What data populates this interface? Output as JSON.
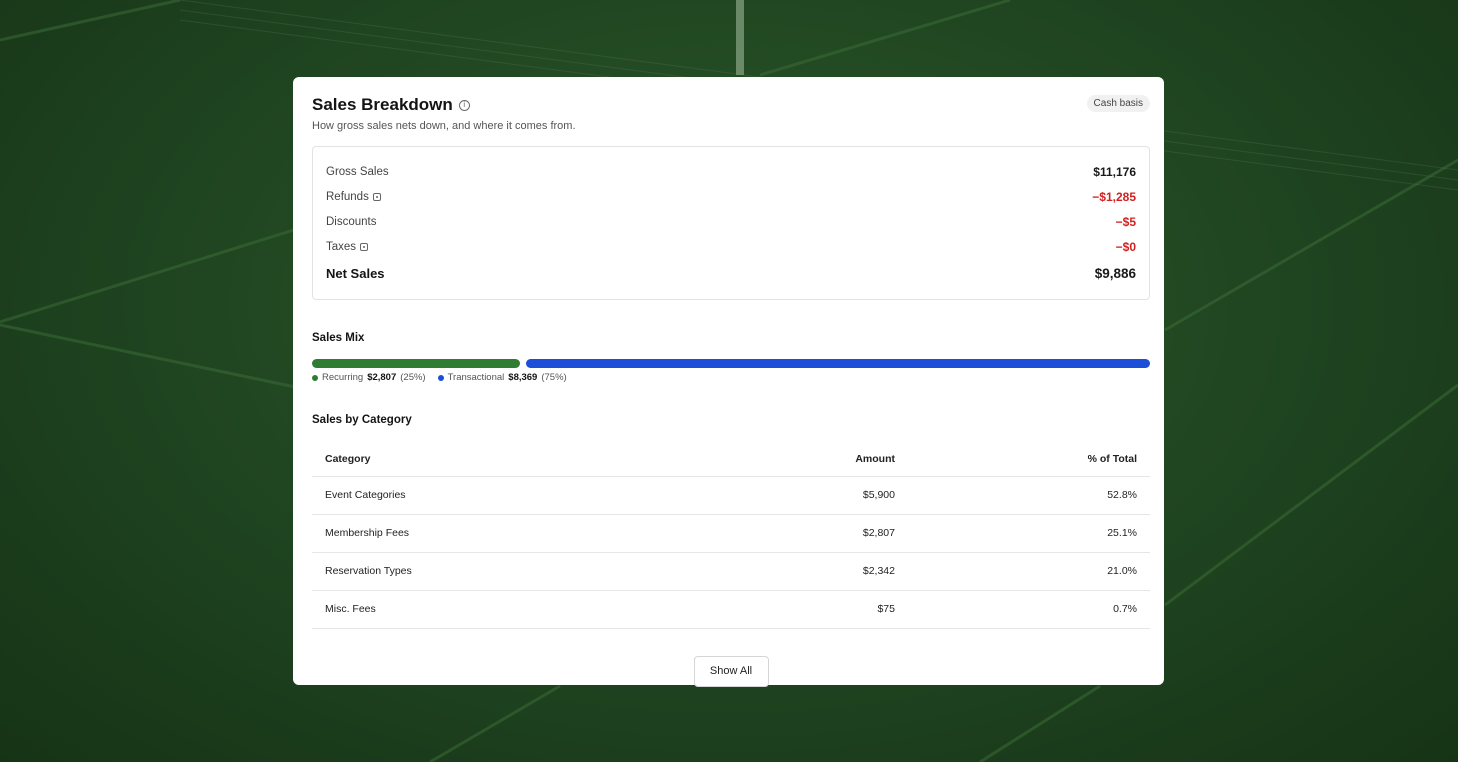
{
  "card": {
    "title": "Sales Breakdown",
    "info_icon": "info-icon",
    "badge": "Cash basis",
    "subtitle": "How gross sales nets down, and where it comes from."
  },
  "summary": {
    "gross": {
      "label": "Gross Sales",
      "value": "$11,176"
    },
    "refunds": {
      "label": "Refunds",
      "value": "−$1,285"
    },
    "discounts": {
      "label": "Discounts",
      "value": "−$5"
    },
    "taxes": {
      "label": "Taxes",
      "value": "−$0"
    },
    "net": {
      "label": "Net Sales",
      "value": "$9,886"
    }
  },
  "mix": {
    "title": "Sales Mix",
    "recurring": {
      "label": "Recurring",
      "amount": "$2,807",
      "pct": "(25%)",
      "fraction": 0.25,
      "color": "#2e7d32"
    },
    "transactional": {
      "label": "Transactional",
      "amount": "$8,369",
      "pct": "(75%)",
      "fraction": 0.75,
      "color": "#1d4ed8"
    }
  },
  "categories": {
    "title": "Sales by Category",
    "headers": {
      "category": "Category",
      "amount": "Amount",
      "pct": "% of Total"
    },
    "rows": [
      {
        "category": "Event Categories",
        "amount": "$5,900",
        "pct": "52.8%"
      },
      {
        "category": "Membership Fees",
        "amount": "$2,807",
        "pct": "25.1%"
      },
      {
        "category": "Reservation Types",
        "amount": "$2,342",
        "pct": "21.0%"
      },
      {
        "category": "Misc. Fees",
        "amount": "$75",
        "pct": "0.7%"
      }
    ]
  },
  "footer": {
    "show_all": "Show All"
  },
  "colors": {
    "negative": "#d32020",
    "background": "#1f4420"
  }
}
